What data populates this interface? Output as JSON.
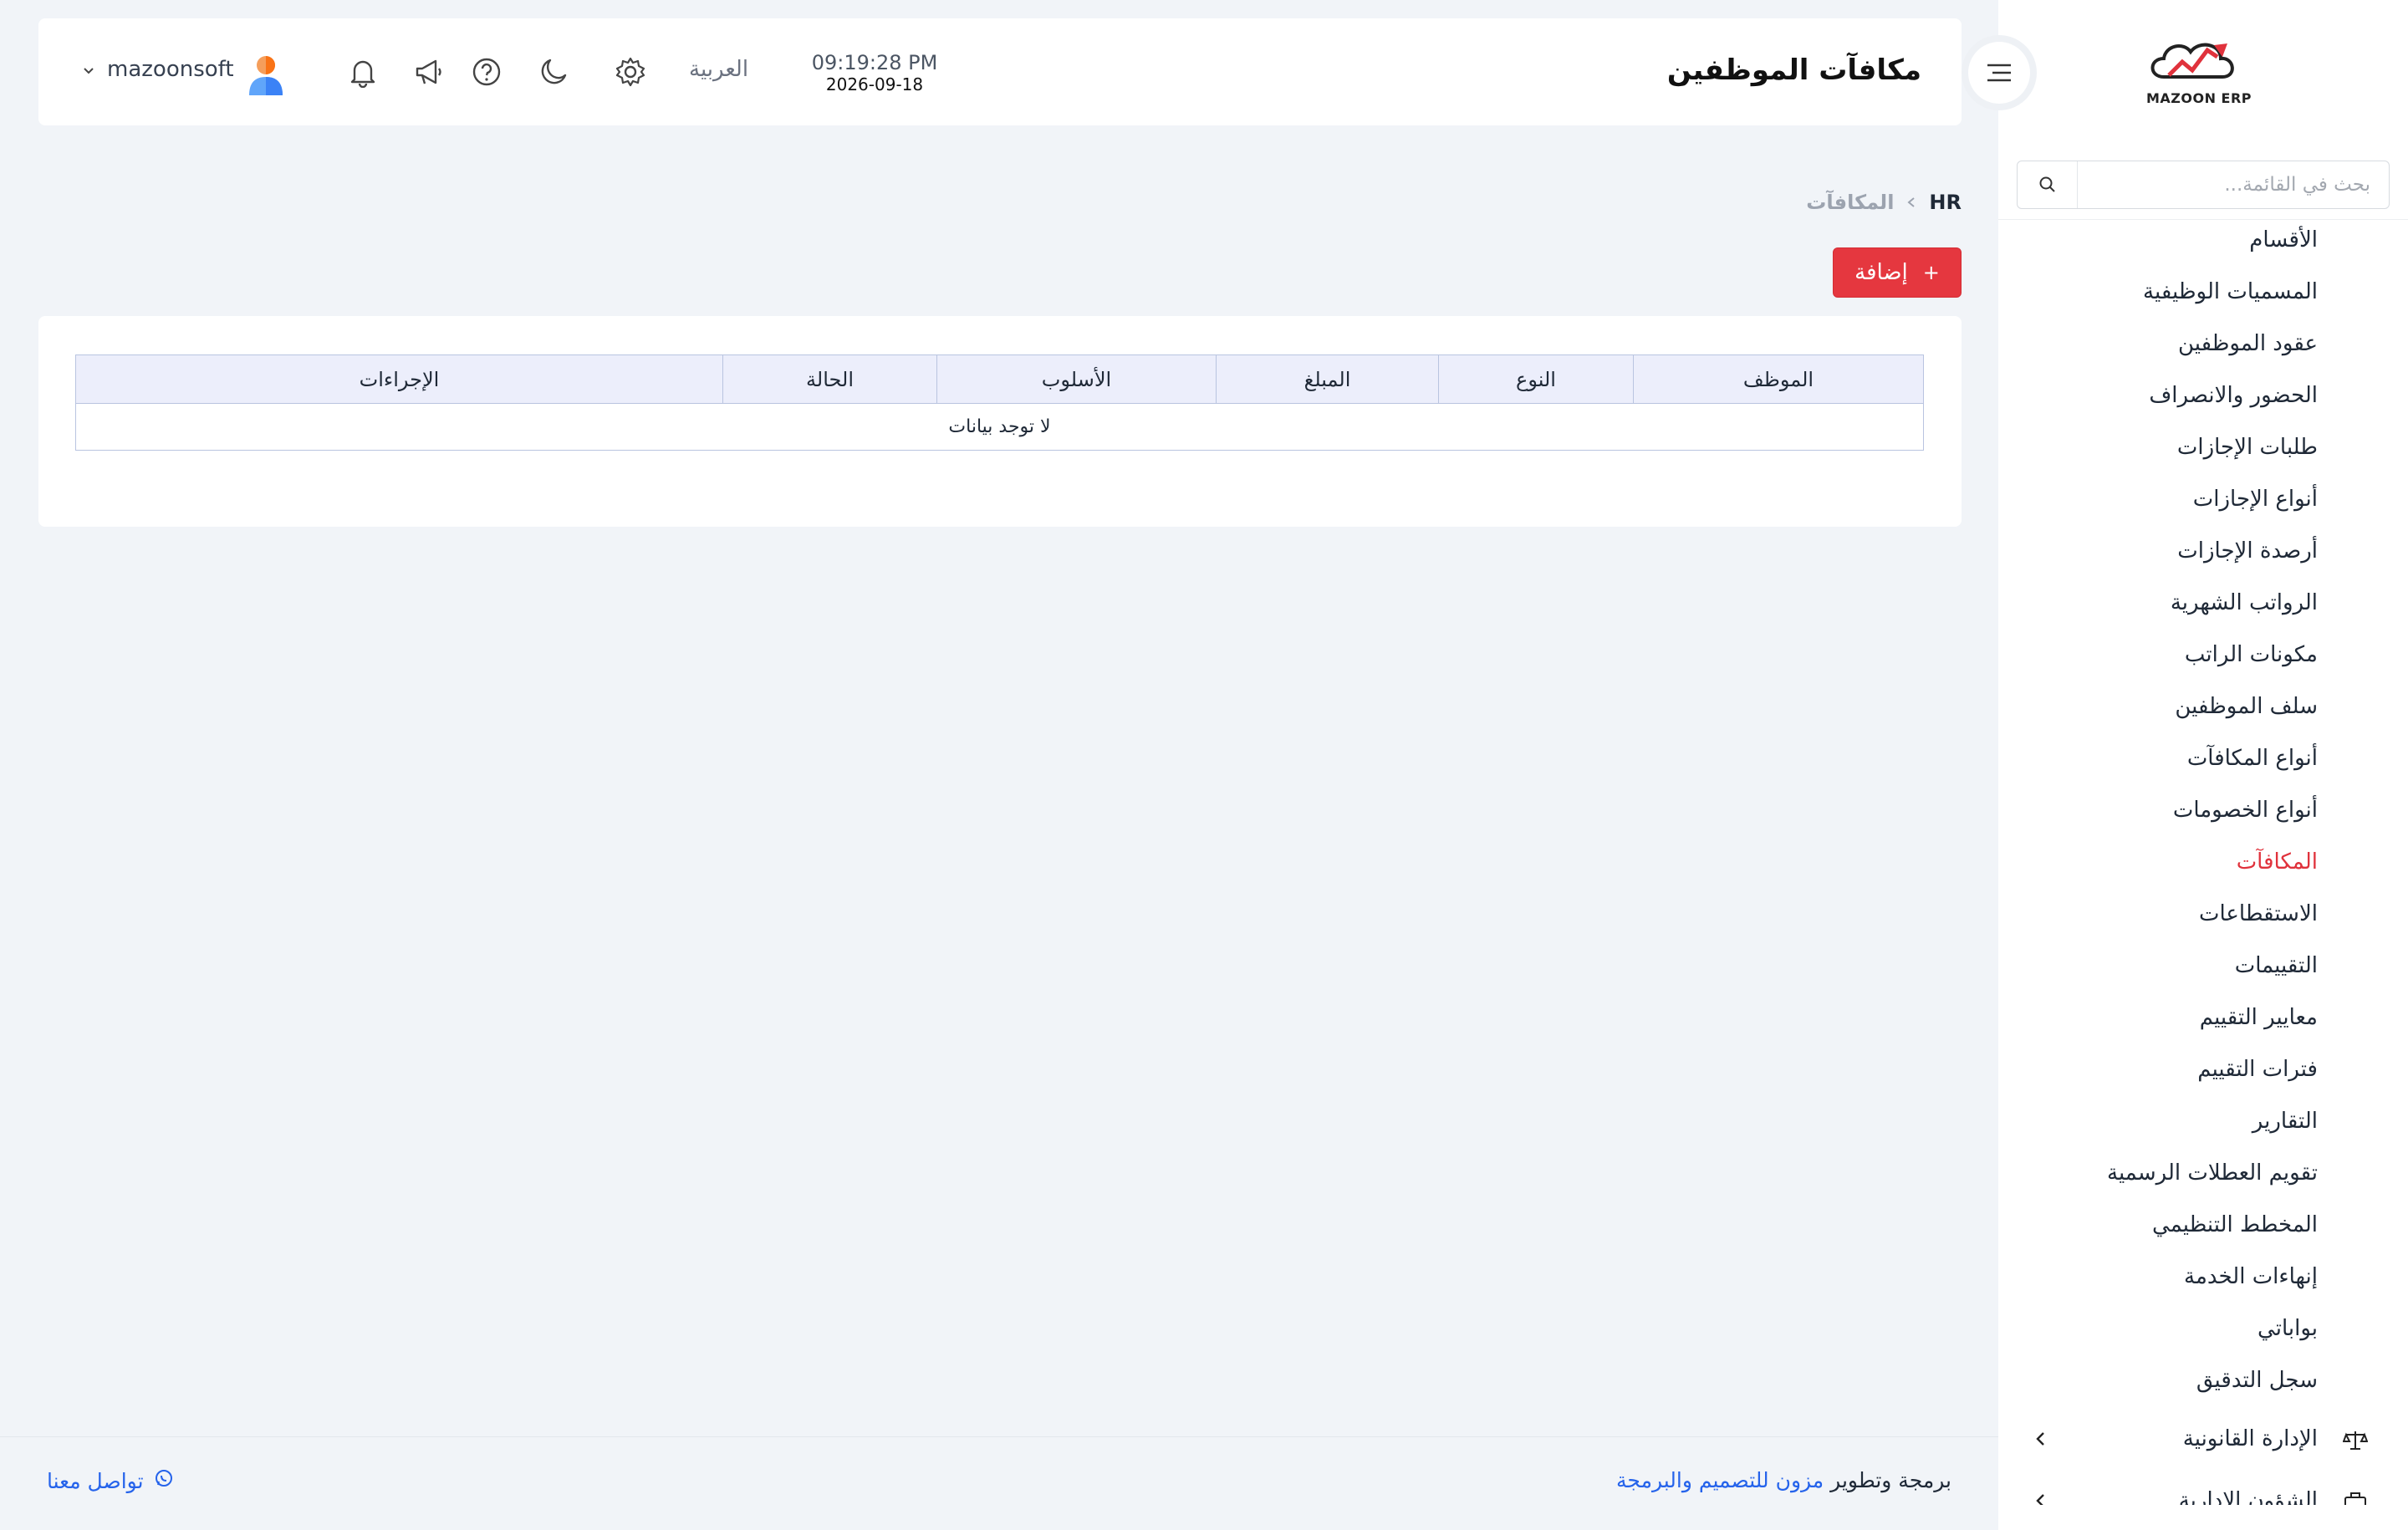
{
  "sidebar": {
    "logo_text": "MAZOON ERP",
    "search_placeholder": "بحث في القائمة...",
    "items": [
      {
        "label": "الأقسام"
      },
      {
        "label": "المسميات الوظيفية"
      },
      {
        "label": "عقود الموظفين"
      },
      {
        "label": "الحضور والانصراف"
      },
      {
        "label": "طلبات الإجازات"
      },
      {
        "label": "أنواع الإجازات"
      },
      {
        "label": "أرصدة الإجازات"
      },
      {
        "label": "الرواتب الشهرية"
      },
      {
        "label": "مكونات الراتب"
      },
      {
        "label": "سلف الموظفين"
      },
      {
        "label": "أنواع المكافآت"
      },
      {
        "label": "أنواع الخصومات"
      },
      {
        "label": "المكافآت",
        "active": true
      },
      {
        "label": "الاستقطاعات"
      },
      {
        "label": "التقييمات"
      },
      {
        "label": "معايير التقييم"
      },
      {
        "label": "فترات التقييم"
      },
      {
        "label": "التقارير"
      },
      {
        "label": "تقويم العطلات الرسمية"
      },
      {
        "label": "المخطط التنظيمي"
      },
      {
        "label": "إنهاءات الخدمة"
      },
      {
        "label": "بواباتي"
      },
      {
        "label": "سجل التدقيق"
      }
    ],
    "groups": [
      {
        "label": "الإدارة القانونية",
        "icon": "scale-icon"
      },
      {
        "label": "الشؤون الإدارية",
        "icon": "briefcase-icon"
      }
    ]
  },
  "header": {
    "title": "مكافآت الموظفين",
    "time": "09:19:28 PM",
    "date": "2026-09-18",
    "language": "العربية",
    "username": "mazoonsoft"
  },
  "breadcrumb": {
    "home": "HR",
    "current": "المكافآت"
  },
  "actions": {
    "add_label": "إضافة",
    "add_icon": "+"
  },
  "table": {
    "columns": [
      "الموظف",
      "النوع",
      "المبلغ",
      "الأسلوب",
      "الحالة",
      "الإجراءات"
    ],
    "empty_text": "لا توجد بيانات"
  },
  "footer": {
    "credit_prefix": "برمجة وتطوير",
    "credit_brand": "مزون للتصميم والبرمجة",
    "contact_label": "تواصل معنا"
  },
  "colors": {
    "accent": "#e5373f",
    "link": "#2563eb",
    "table_header_bg": "#eceefb",
    "page_bg": "#f1f4f8"
  }
}
